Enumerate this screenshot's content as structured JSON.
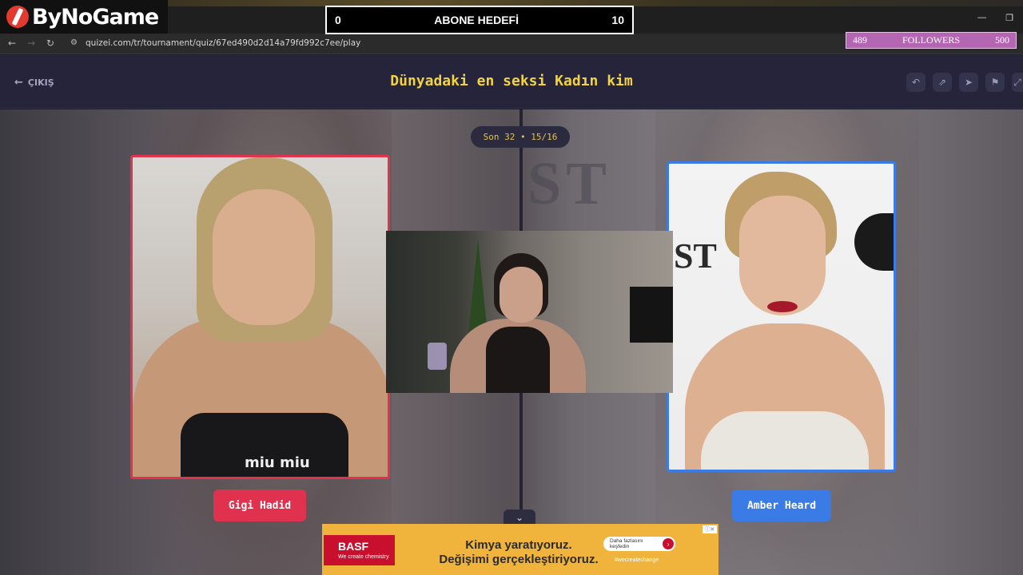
{
  "overlay": {
    "brand": "ByNoGame",
    "goal": {
      "left": "0",
      "title": "ABONE HEDEFİ",
      "right": "10",
      "current": 0,
      "target": 10
    },
    "followers": {
      "current": "489",
      "label": "FOLLOWERS",
      "target": "500"
    }
  },
  "browser": {
    "url": "quizei.com/tr/tournament/quiz/67ed490d2d14a79fd992c7ee/play",
    "window_controls": [
      "minimize",
      "restore"
    ]
  },
  "header": {
    "exit_label": "ÇIKIŞ",
    "title": "Dünyadaki en seksi Kadın kim",
    "tools": [
      "undo-icon",
      "share-icon",
      "send-icon",
      "flag-icon",
      "expand-icon"
    ]
  },
  "round": {
    "label": "Son 32 • 15/16"
  },
  "contestants": [
    {
      "name": "Gigi Hadid",
      "color": "#e0324e",
      "shirt_text": "miu miu"
    },
    {
      "name": "Amber Heard",
      "color": "#3a7be6",
      "backdrop_text": "ST"
    }
  ],
  "ad": {
    "brand": "BASF",
    "brand_tag": "We create chemistry",
    "line1": "Kimya yaratıyoruz.",
    "line2": "Değişimi gerçekleştiriyoruz.",
    "cta": "Daha fazlasını keşfedin",
    "hashtag": "#wecreatechange",
    "brand_color": "#c8102e",
    "background_color": "#f0b43c"
  },
  "colors": {
    "accent_title": "#f1d23f",
    "left": "#e0324e",
    "right": "#3a7be6"
  }
}
